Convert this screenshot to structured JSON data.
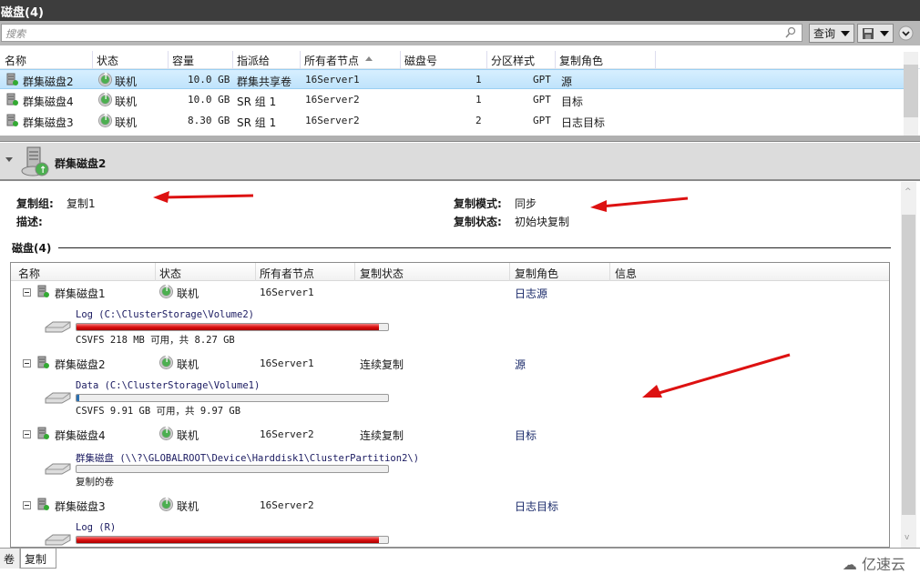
{
  "window": {
    "title": "磁盘(4)"
  },
  "search": {
    "placeholder": "搜索",
    "query_label": "查询"
  },
  "grid": {
    "columns": [
      "名称",
      "状态",
      "容量",
      "指派给",
      "所有者节点",
      "磁盘号",
      "分区样式",
      "复制角色"
    ],
    "rows": [
      {
        "name": "群集磁盘2",
        "status": "联机",
        "capacity": "10.0 GB",
        "assigned": "群集共享卷",
        "owner": "16Server1",
        "disk_no": "1",
        "partition": "GPT",
        "role": "源",
        "selected": true
      },
      {
        "name": "群集磁盘4",
        "status": "联机",
        "capacity": "10.0 GB",
        "assigned": "SR 组 1",
        "owner": "16Server2",
        "disk_no": "1",
        "partition": "GPT",
        "role": "目标",
        "selected": false
      },
      {
        "name": "群集磁盘3",
        "status": "联机",
        "capacity": "8.30 GB",
        "assigned": "SR 组 1",
        "owner": "16Server2",
        "disk_no": "2",
        "partition": "GPT",
        "role": "日志目标",
        "selected": false
      }
    ]
  },
  "detail": {
    "title": "群集磁盘2",
    "group_label": "复制组:",
    "group_value": "复制1",
    "desc_label": "描述:",
    "mode_label": "复制模式:",
    "mode_value": "同步",
    "state_label": "复制状态:",
    "state_value": "初始块复制",
    "disks_section": "磁盘(4)",
    "disk_columns": [
      "名称",
      "状态",
      "所有者节点",
      "复制状态",
      "复制角色",
      "信息"
    ],
    "disks": [
      {
        "name": "群集磁盘1",
        "status": "联机",
        "owner": "16Server1",
        "rep_state": "",
        "role": "日志源",
        "volume": "Log (C:\\ClusterStorage\\Volume2)",
        "usage": "CSVFS 218 MB 可用，共 8.27 GB",
        "used_fraction": 0.97
      },
      {
        "name": "群集磁盘2",
        "status": "联机",
        "owner": "16Server1",
        "rep_state": "连续复制",
        "role": "源",
        "volume": "Data (C:\\ClusterStorage\\Volume1)",
        "usage": "CSVFS 9.91 GB 可用，共 9.97 GB",
        "used_fraction": 0.006
      },
      {
        "name": "群集磁盘4",
        "status": "联机",
        "owner": "16Server2",
        "rep_state": "连续复制",
        "role": "目标",
        "volume": "群集磁盘 (\\\\?\\GLOBALROOT\\Device\\Harddisk1\\ClusterPartition2\\)",
        "usage": "复制的卷",
        "used_fraction": 0
      },
      {
        "name": "群集磁盘3",
        "status": "联机",
        "owner": "16Server2",
        "rep_state": "",
        "role": "日志目标",
        "volume": "Log (R)",
        "usage": "",
        "used_fraction": 0.97
      }
    ]
  },
  "tabs": [
    "卷",
    "复制"
  ],
  "watermark": "亿速云"
}
